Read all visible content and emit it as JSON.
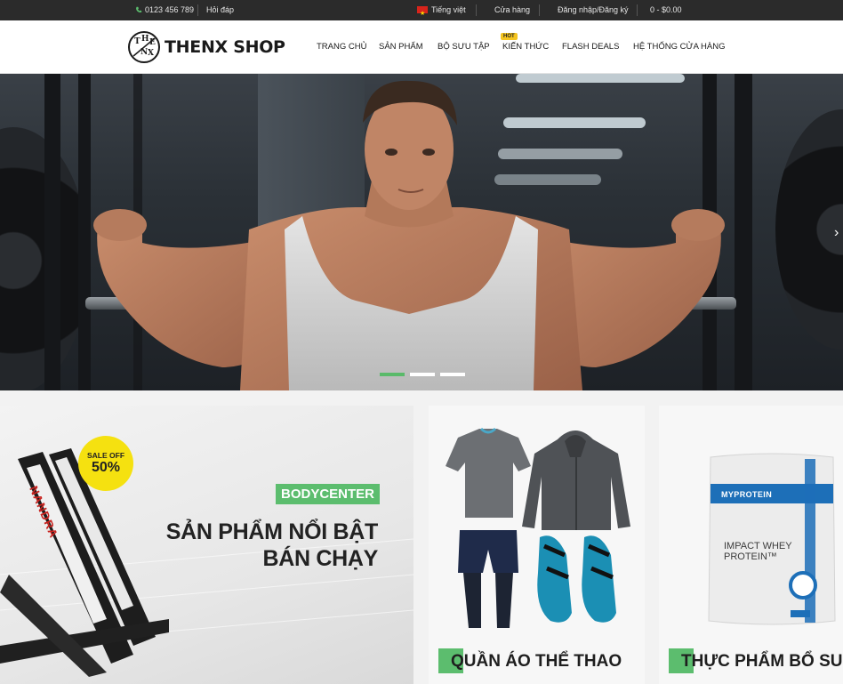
{
  "topbar": {
    "phone": "0123 456 789",
    "faq": "Hỏi đáp",
    "language": "Tiếng việt",
    "stores": "Cửa hàng",
    "login": "Đăng nhập/Đăng ký",
    "cart": "0 - $0.00"
  },
  "header": {
    "logo_text": "THENX SHOP",
    "nav": [
      "TRANG CHỦ",
      "SẢN PHẨM",
      "BỘ SƯU TẬP",
      "KIẾN THỨC",
      "FLASH DEALS",
      "HỆ THỐNG CỬA HÀNG"
    ],
    "hot_badge": "HOT"
  },
  "hero": {
    "slides_total": 3,
    "active_slide": 1
  },
  "promos": {
    "main": {
      "tag": "BODYCENTER",
      "headline_line1": "SẢN PHẨM NỔI BẬT",
      "headline_line2": "BÁN CHẠY",
      "sale_line1": "SALE OFF",
      "sale_line2": "50%",
      "brand_on_equipment": "NANDRA"
    },
    "clothing": {
      "label": "QUẦN ÁO THỂ THAO"
    },
    "supplements": {
      "label": "THỰC PHẨM BỔ SUNG",
      "brand": "MYPROTEIN",
      "product_line1": "IMPACT WHEY",
      "product_line2": "PROTEIN™"
    }
  },
  "colors": {
    "accent_green": "#5cbd6e",
    "topbar_bg": "#2b2b2b",
    "sale_yellow": "#f5e110",
    "hot_yellow": "#f4c41f"
  }
}
